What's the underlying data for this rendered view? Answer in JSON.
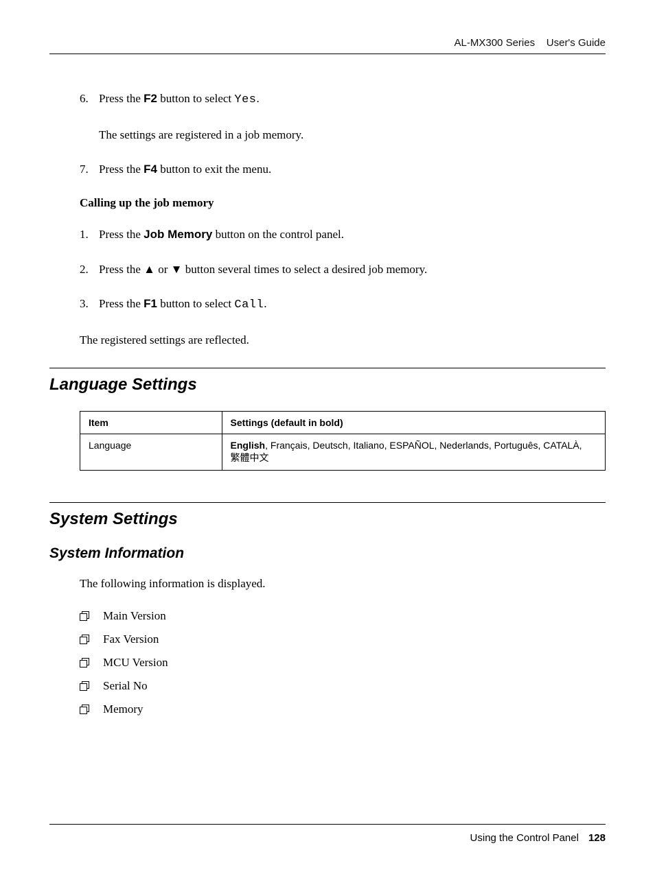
{
  "header": {
    "series": "AL-MX300 Series",
    "doc": "User's Guide"
  },
  "steps_top": [
    {
      "n": "6.",
      "pre": "Press the ",
      "bold": "F2",
      "post": " button to select ",
      "mono": "Yes",
      "tail": "."
    },
    {
      "n": "7.",
      "pre": "Press the ",
      "bold": "F4",
      "post": " button to exit the menu.",
      "mono": "",
      "tail": ""
    }
  ],
  "step6_follow": "The settings are registered in a job memory.",
  "subhead_calling": "Calling up the job memory",
  "steps_call": [
    {
      "n": "1.",
      "pre": "Press the ",
      "bold": "Job Memory",
      "post": " button on the control panel.",
      "mono": "",
      "tail": ""
    },
    {
      "n": "2.",
      "pre": "Press the ",
      "arrows": true,
      "post2": " button several times to select a desired job memory."
    },
    {
      "n": "3.",
      "pre": "Press the ",
      "bold": "F1",
      "post": " button to select ",
      "mono": "Call",
      "tail": "."
    }
  ],
  "reflected": "The registered settings are reflected.",
  "h2_language": "Language Settings",
  "table": {
    "head_item": "Item",
    "head_settings": "Settings (default in bold)",
    "row_item": "Language",
    "row_default": "English",
    "row_rest": ", Français, Deutsch, Italiano, ESPAÑOL, Nederlands, Português, ",
    "row_catala": "CATALÀ",
    "row_comma": ", ",
    "row_cjk": "繁體中文"
  },
  "h2_system": "System Settings",
  "h3_sysinfo": "System Information",
  "sysinfo_intro": "The following information is displayed.",
  "info_items": [
    "Main Version",
    "Fax Version",
    "MCU Version",
    "Serial No",
    "Memory"
  ],
  "footer": {
    "section": "Using the Control Panel",
    "page": "128"
  },
  "glyphs": {
    "up": "▲",
    "down": "▼",
    "or": " or "
  }
}
